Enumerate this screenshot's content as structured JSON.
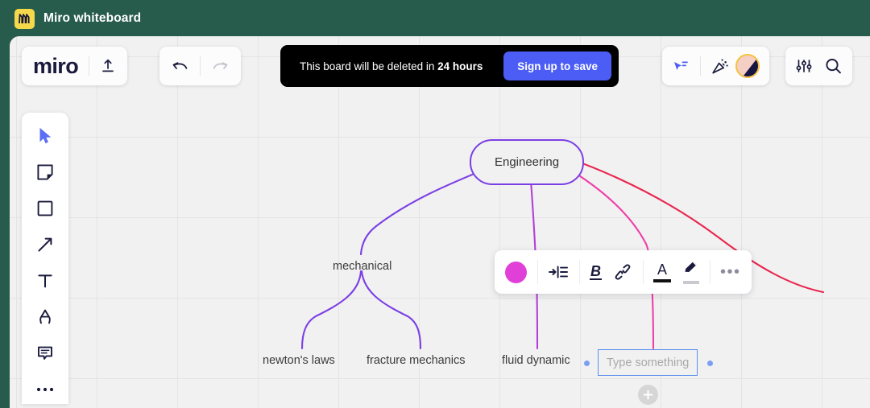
{
  "window": {
    "title": "Miro whiteboard",
    "app_icon": "miro-logo-icon",
    "titlebar_color": "#275c4c"
  },
  "board": {
    "background": "#f1f1f1",
    "grid_visible": true,
    "grid_spacing": 100
  },
  "top_left_panel": {
    "wordmark": "miro",
    "export_icon": "upload-icon"
  },
  "history_panel": {
    "undo_icon": "undo-arrow-icon",
    "redo_icon": "redo-arrow-icon",
    "undo_enabled": "true",
    "redo_enabled": "false"
  },
  "banner": {
    "message_prefix": "This board will be deleted in ",
    "message_highlight": "24 hours",
    "signup_label": "Sign up to save",
    "accent": "#4b5df5",
    "background": "#000000"
  },
  "top_right_panel": {
    "present_icon": "cursor-share-icon",
    "celebrate_icon": "confetti-icon",
    "avatar_icon": "user-avatar",
    "avatar_ring_color": "#f5c242"
  },
  "top_far_right_panel": {
    "settings_icon": "sliders-icon",
    "search_icon": "search-icon"
  },
  "left_toolbar": {
    "items": [
      {
        "name": "select-tool",
        "icon": "cursor-arrow-icon",
        "active": "true"
      },
      {
        "name": "sticky-note-tool",
        "icon": "sticky-note-icon",
        "active": "false"
      },
      {
        "name": "shapes-tool",
        "icon": "square-icon",
        "active": "false"
      },
      {
        "name": "connector-tool",
        "icon": "arrow-diagonal-icon",
        "active": "false"
      },
      {
        "name": "text-tool",
        "icon": "letter-t-icon",
        "active": "false"
      },
      {
        "name": "pen-tool",
        "icon": "pen-nib-icon",
        "active": "false"
      },
      {
        "name": "comment-tool",
        "icon": "comment-bubble-icon",
        "active": "false"
      },
      {
        "name": "more-tools",
        "icon": "ellipsis-icon",
        "active": "false"
      }
    ]
  },
  "format_toolbar": {
    "color_swatch": "#e040d8",
    "indent_icon": "indent-icon",
    "bold_label": "B",
    "link_icon": "link-chain-icon",
    "text_color_label": "A",
    "text_color_value": "#111111",
    "highlight_icon": "pencil-icon",
    "highlight_value": "#c9c9cf",
    "more_label": "•••"
  },
  "mindmap": {
    "root": {
      "label": "Engineering",
      "border_color": "#7b3fe4"
    },
    "nodes": [
      {
        "label": "mechanical",
        "level": 1,
        "connector_color": "#7b3fe4"
      },
      {
        "label": "newton's laws",
        "level": 2,
        "connector_color": "#7b3fe4"
      },
      {
        "label": "fracture mechanics",
        "level": 2,
        "connector_color": "#7b3fe4"
      },
      {
        "label": "fluid dynamic",
        "level": 1,
        "connector_color": "#b33fd8"
      },
      {
        "label": "",
        "level": 1,
        "connector_color": "#ef3fa8",
        "editing": "true"
      }
    ],
    "connector_colors": [
      "#7b3fe4",
      "#b33fd8",
      "#ef3fa8",
      "#e8264f"
    ],
    "new_node_input": {
      "placeholder": "Type something",
      "value": "",
      "border_color": "#5b8df0"
    },
    "add_button_label": "+",
    "dot_color": "#7b9ff2"
  }
}
